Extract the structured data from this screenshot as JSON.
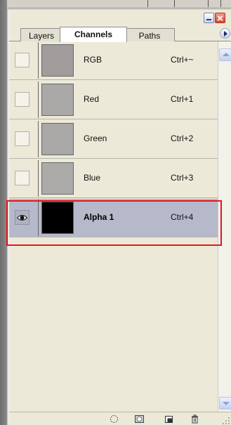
{
  "panel": {
    "tabs": [
      {
        "label": "Layers"
      },
      {
        "label": "Channels"
      },
      {
        "label": "Paths"
      }
    ],
    "active_tab": "Channels"
  },
  "channels": [
    {
      "name": "RGB",
      "shortcut": "Ctrl+~",
      "visible": false,
      "selected": false,
      "thumb_color": "#a09d9c"
    },
    {
      "name": "Red",
      "shortcut": "Ctrl+1",
      "visible": false,
      "selected": false,
      "thumb_color": "#aaa9a8"
    },
    {
      "name": "Green",
      "shortcut": "Ctrl+2",
      "visible": false,
      "selected": false,
      "thumb_color": "#a9a8a7"
    },
    {
      "name": "Blue",
      "shortcut": "Ctrl+3",
      "visible": false,
      "selected": false,
      "thumb_color": "#acabaa"
    },
    {
      "name": "Alpha 1",
      "shortcut": "Ctrl+4",
      "visible": true,
      "selected": true,
      "thumb_color": "#000000"
    }
  ],
  "colors": {
    "selection_highlight": "#e8141c",
    "selected_row_bg": "#b5b9c9"
  },
  "icons": {
    "visibility": "eye-icon",
    "bottom_bar": [
      "load-channel-as-selection-icon",
      "save-selection-as-channel-icon",
      "new-channel-icon",
      "delete-channel-icon"
    ]
  }
}
